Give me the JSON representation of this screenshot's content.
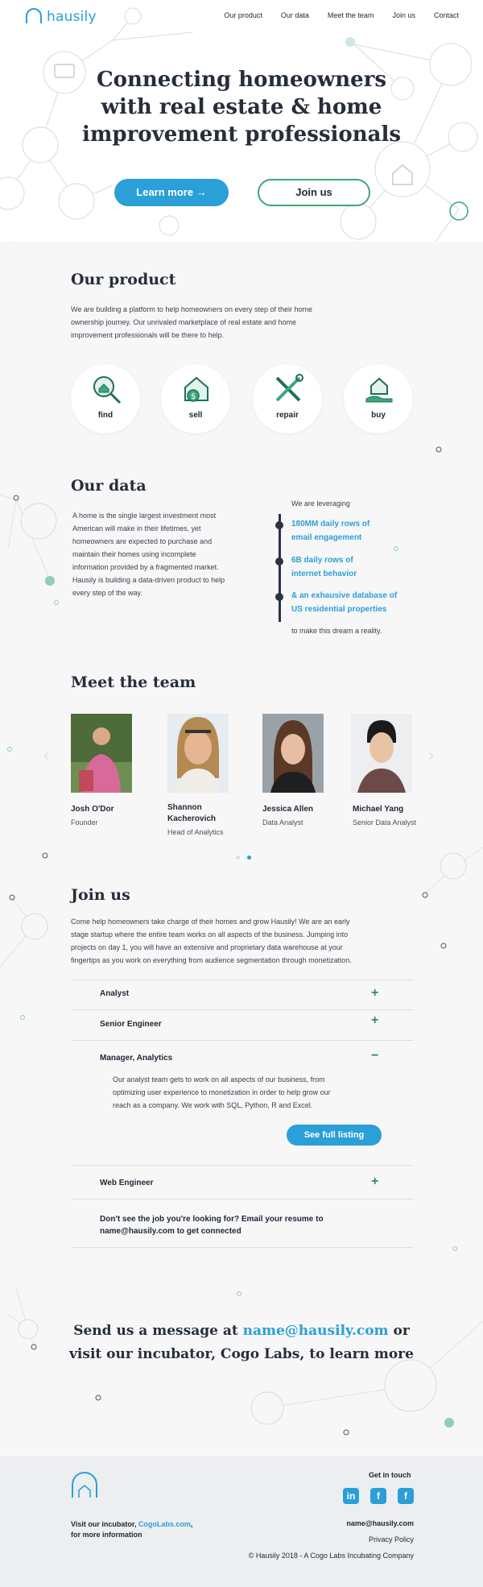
{
  "brand": {
    "name": "hausily",
    "accent": "#2a9fd8",
    "green": "#3aa878"
  },
  "nav": {
    "items": [
      "Our product",
      "Our data",
      "Meet the team",
      "Join us",
      "Contact"
    ]
  },
  "hero": {
    "title_line1": "Connecting homeowners",
    "title_line2": "with real estate & home",
    "title_line3": "improvement professionals",
    "learn_more": "Learn more →",
    "join_us": "Join us"
  },
  "product": {
    "title": "Our product",
    "text_l1": "We are building a platform to help homeowners on every step of their home",
    "text_l2": "ownership journey. Our unrivaled marketplace of real estate and home",
    "text_l3": "improvement professionals will be there to help.",
    "items": [
      {
        "label": "find",
        "icon": "magnifier-house-icon"
      },
      {
        "label": "sell",
        "icon": "house-dollar-icon"
      },
      {
        "label": "repair",
        "icon": "tools-icon"
      },
      {
        "label": "buy",
        "icon": "hand-house-icon"
      }
    ]
  },
  "data": {
    "title": "Our data",
    "text_l1": "A home is the single largest investment most",
    "text_l2": "American will make in their lifetimes, yet",
    "text_l3": "homeowners are expected to purchase and",
    "text_l4": "maintain their homes using incomplete",
    "text_l5": "information provided by a fragmented market.",
    "text_l6": "Hausily is building a data-driven product to help",
    "text_l7": "every step of the way.",
    "leveraging": "We are leveraging",
    "stat1_l1": "180MM daily rows of",
    "stat1_l2": "email engagement",
    "stat2_l1": "6B daily rows of",
    "stat2_l2": "internet behavior",
    "stat3_l1": "& an exhausive database of",
    "stat3_l2": "US residential properties",
    "closing": "to make this dream a reality."
  },
  "team": {
    "title": "Meet the team",
    "members": [
      {
        "name": "Josh O'Dor",
        "role": "Founder"
      },
      {
        "name_l1": "Shannon",
        "name_l2": "Kacherovich",
        "role": "Head of Analytics"
      },
      {
        "name": "Jessica Allen",
        "role": "Data Analyst"
      },
      {
        "name": "Michael Yang",
        "role": "Senior Data Analyst"
      }
    ]
  },
  "join": {
    "title": "Join us",
    "text_l1": "Come help homeowners take charge of their homes and grow Hausily! We are an early",
    "text_l2": "stage startup where the entire team works on all aspects of the business. Jumping into",
    "text_l3": "projects on day 1, you will have an extensive and proprietary data warehouse at your",
    "text_l4": "fingertips as you work on everything from audience segmentation through monetization.",
    "jobs": [
      {
        "title": "Analyst",
        "icon": "+"
      },
      {
        "title": "Senior Engineer",
        "icon": "+"
      },
      {
        "title": "Manager, Analytics",
        "icon": "−"
      },
      {
        "title": "Web Engineer",
        "icon": "+"
      }
    ],
    "detail_l1": "Our analyst team gets to work on all aspects of our business, from",
    "detail_l2": "optimizing user experience to monetization in order to help grow our",
    "detail_l3": "reach as a company. We work with SQL, Python, R and Excel.",
    "see_listing": "See full listing",
    "cta_l1": "Don't see the job you're looking for? Email your resume to",
    "cta_l2": "name@hausily.com to get connected"
  },
  "contact": {
    "l1_pre": "Send us a message at ",
    "email": "name@hausily.com",
    "l1_post": " or",
    "l2": "visit our incubator, Cogo Labs, to learn more"
  },
  "footer": {
    "incubator_pre": "Visit our incubator, ",
    "incubator_link": "CogoLabs.com",
    "incubator_post": ",",
    "incubator_l2": "for more information",
    "get_in_touch": "Get in touch",
    "social": [
      "in",
      "f",
      "f"
    ],
    "email": "name@hausily.com",
    "privacy": "Privacy Policy",
    "copyright": "© Hausily 2018 - A Cogo Labs Incubating Company"
  }
}
